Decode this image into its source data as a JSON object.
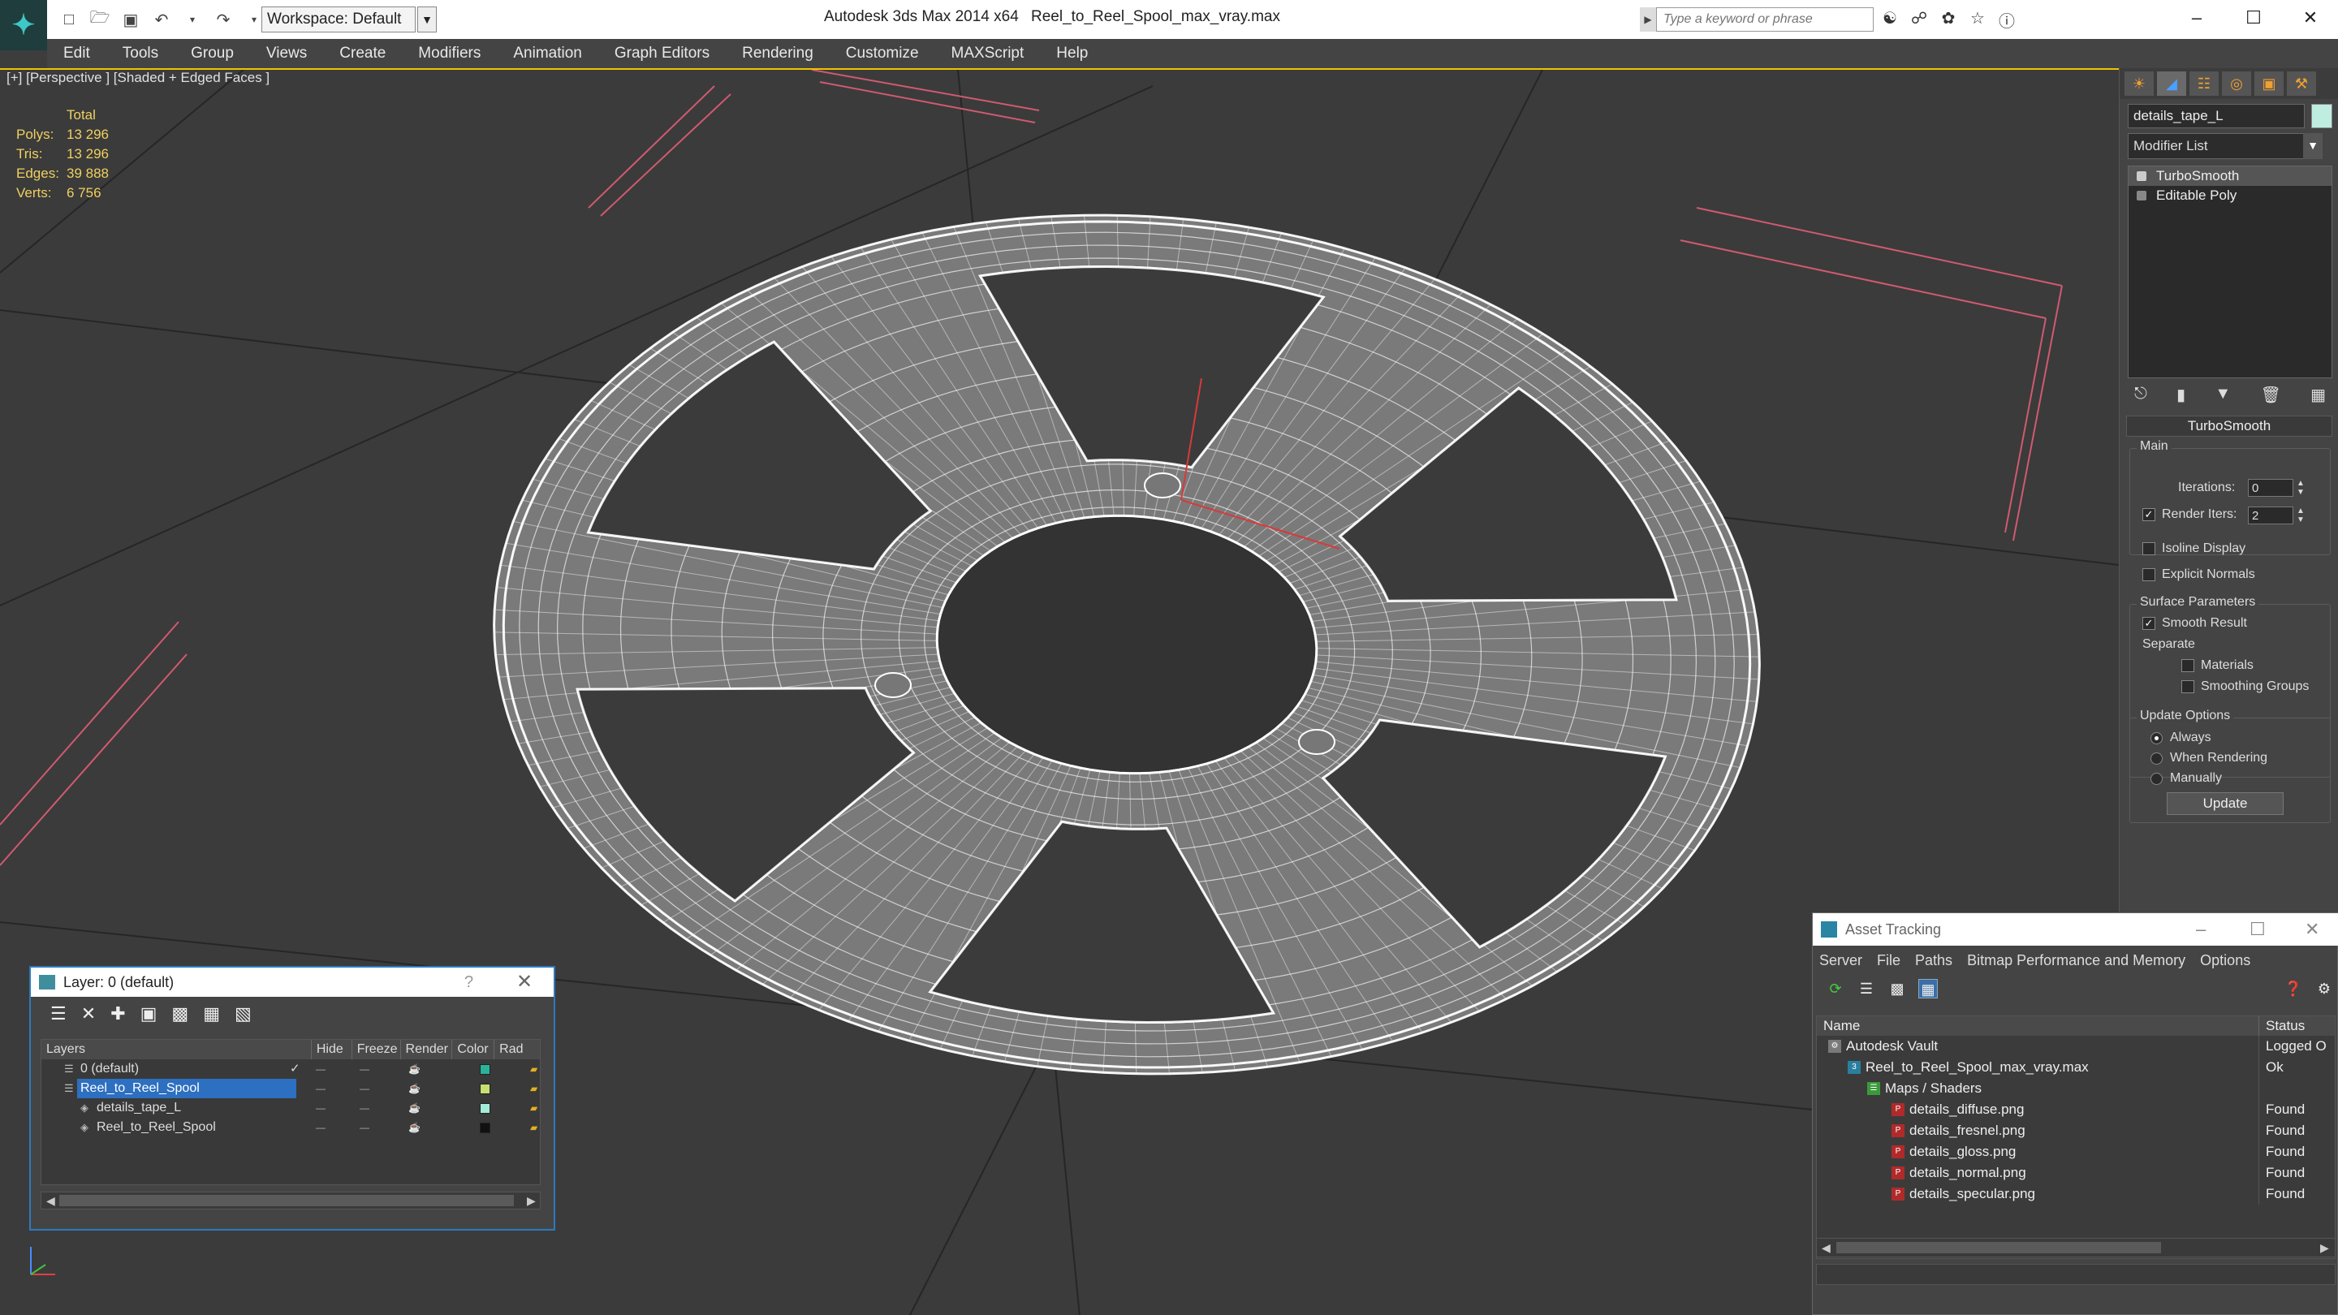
{
  "titlebar": {
    "workspace": "Workspace: Default",
    "app_title": "Autodesk 3ds Max 2014 x64",
    "file_title": "Reel_to_Reel_Spool_max_vray.max",
    "search_placeholder": "Type a keyword or phrase"
  },
  "menu": [
    "Edit",
    "Tools",
    "Group",
    "Views",
    "Create",
    "Modifiers",
    "Animation",
    "Graph Editors",
    "Rendering",
    "Customize",
    "MAXScript",
    "Help"
  ],
  "viewport": {
    "label": "[+] [Perspective ] [Shaded + Edged Faces ]",
    "stats": {
      "header": "Total",
      "rows": [
        {
          "label": "Polys:",
          "value": "13 296"
        },
        {
          "label": "Tris:",
          "value": "13 296"
        },
        {
          "label": "Edges:",
          "value": "39 888"
        },
        {
          "label": "Verts:",
          "value": "6 756"
        }
      ]
    }
  },
  "command_panel": {
    "object_name": "details_tape_L",
    "object_color": "#bfeee0",
    "modifier_list": "Modifier List",
    "stack": [
      "TurboSmooth",
      "Editable Poly"
    ],
    "rollout_title": "TurboSmooth",
    "main_label": "Main",
    "iterations_label": "Iterations:",
    "iterations_value": "0",
    "render_iters_label": "Render Iters:",
    "render_iters_value": "2",
    "isoline_label": "Isoline Display",
    "explicit_normals_label": "Explicit Normals",
    "surface_params_label": "Surface Parameters",
    "smooth_result_label": "Smooth Result",
    "separate_label": "Separate",
    "materials_label": "Materials",
    "smoothing_groups_label": "Smoothing Groups",
    "update_options_label": "Update Options",
    "always_label": "Always",
    "when_rendering_label": "When Rendering",
    "manually_label": "Manually",
    "update_button": "Update"
  },
  "layer_window": {
    "title": "Layer: 0 (default)",
    "help": "?",
    "columns": [
      "Layers",
      "Hide",
      "Freeze",
      "Render",
      "Color",
      "Rad"
    ],
    "rows": [
      {
        "name": "0 (default)",
        "color": "#2ab39a",
        "indent": 1,
        "selected": false
      },
      {
        "name": "Reel_to_Reel_Spool",
        "color": "#c8e070",
        "indent": 1,
        "selected": true
      },
      {
        "name": "details_tape_L",
        "color": "#a4ecd8",
        "indent": 2,
        "selected": false
      },
      {
        "name": "Reel_to_Reel_Spool",
        "color": "#111111",
        "indent": 2,
        "selected": false
      }
    ]
  },
  "asset_window": {
    "title": "Asset Tracking",
    "menu": [
      "Server",
      "File",
      "Paths",
      "Bitmap Performance and Memory",
      "Options"
    ],
    "columns": [
      "Name",
      "Status"
    ],
    "rows": [
      {
        "name": "Autodesk Vault",
        "status": "Logged O",
        "indent": 0,
        "icon": "vault"
      },
      {
        "name": "Reel_to_Reel_Spool_max_vray.max",
        "status": "Ok",
        "indent": 1,
        "icon": "max"
      },
      {
        "name": "Maps / Shaders",
        "status": "",
        "indent": 2,
        "icon": "maps"
      },
      {
        "name": "details_diffuse.png",
        "status": "Found",
        "indent": 3,
        "icon": "png"
      },
      {
        "name": "details_fresnel.png",
        "status": "Found",
        "indent": 3,
        "icon": "png"
      },
      {
        "name": "details_gloss.png",
        "status": "Found",
        "indent": 3,
        "icon": "png"
      },
      {
        "name": "details_normal.png",
        "status": "Found",
        "indent": 3,
        "icon": "png"
      },
      {
        "name": "details_specular.png",
        "status": "Found",
        "indent": 3,
        "icon": "png"
      }
    ]
  }
}
